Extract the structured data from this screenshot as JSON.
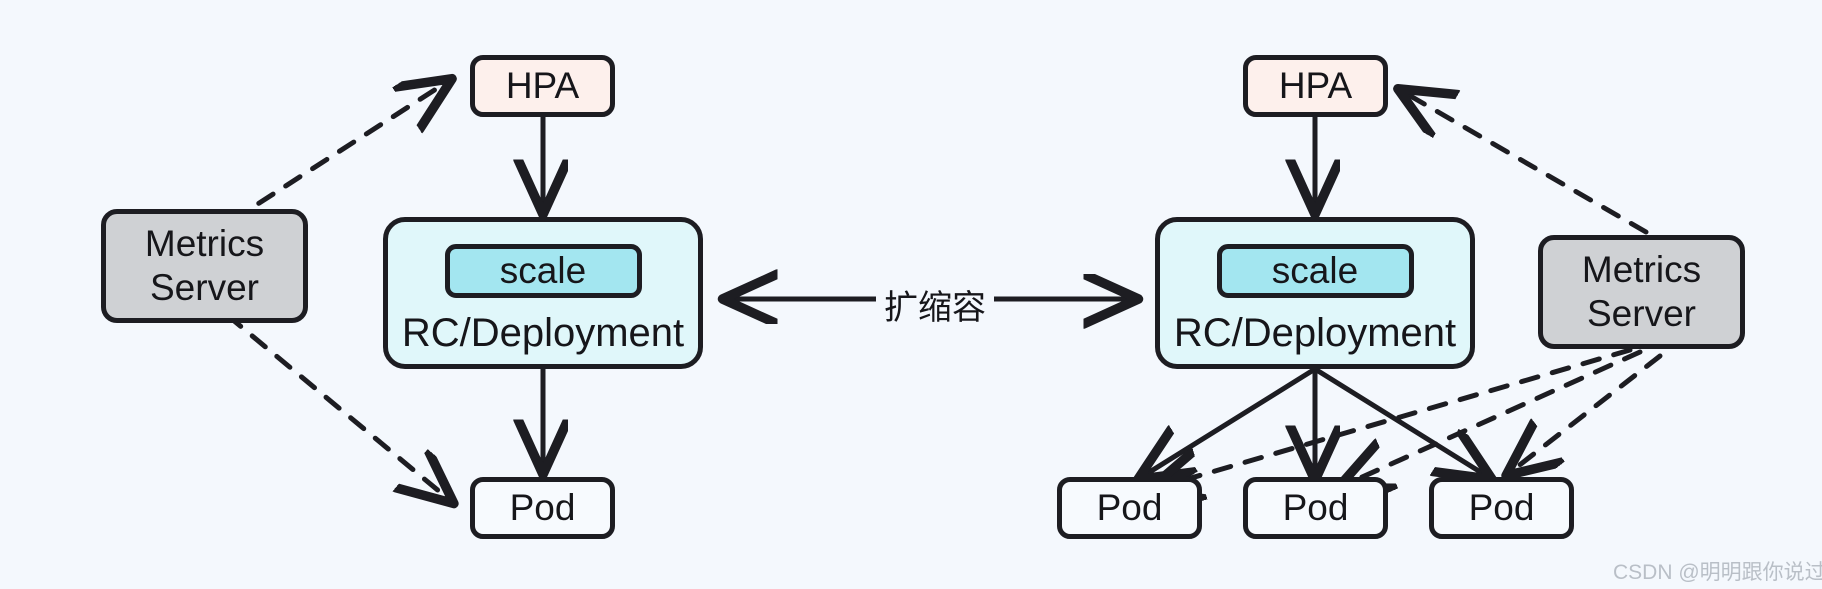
{
  "diagram": {
    "title": "Kubernetes HPA scaling diagram",
    "background_color": "#f4f8fd",
    "stroke_color": "#1d1d22",
    "colors": {
      "hpa_fill": "#fdf0ec",
      "metrics_fill": "#cfd1d4",
      "pod_fill": "#f7fafe",
      "rc_fill": "#e0f7fa",
      "scale_fill": "#a3e6f0"
    }
  },
  "left": {
    "hpa": {
      "label": "HPA"
    },
    "metrics_server": {
      "label": "Metrics\nServer"
    },
    "rc_deployment": {
      "caption": "RC/Deployment",
      "scale_label": "scale"
    },
    "pods": [
      {
        "label": "Pod"
      }
    ]
  },
  "right": {
    "hpa": {
      "label": "HPA"
    },
    "metrics_server": {
      "label": "Metrics\nServer"
    },
    "rc_deployment": {
      "caption": "RC/Deployment",
      "scale_label": "scale"
    },
    "pods": [
      {
        "label": "Pod"
      },
      {
        "label": "Pod"
      },
      {
        "label": "Pod"
      }
    ]
  },
  "center": {
    "edge_label": "扩缩容"
  },
  "watermark": {
    "text": "CSDN @明明跟你说过"
  }
}
